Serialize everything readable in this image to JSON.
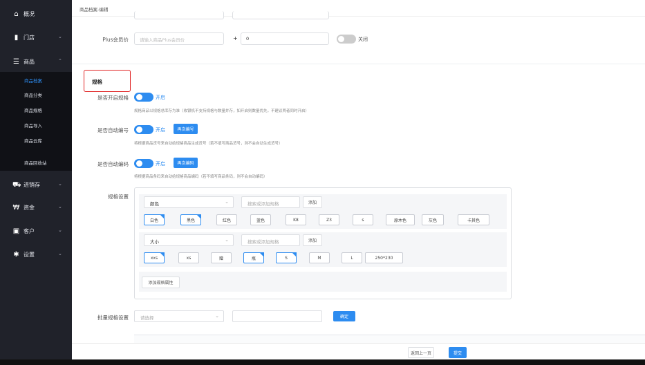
{
  "sidebar": {
    "items": [
      {
        "label": "概况",
        "icon": "home-icon",
        "glyph": "⌂",
        "chevron": ""
      },
      {
        "label": "门店",
        "icon": "store-icon",
        "glyph": "▮",
        "chevron": "⌄"
      },
      {
        "label": "商品",
        "icon": "list-icon",
        "glyph": "☰",
        "chevron": "⌃"
      },
      {
        "label": "进销存",
        "icon": "truck-icon",
        "glyph": "⛟",
        "chevron": "⌄"
      },
      {
        "label": "资金",
        "icon": "won-icon",
        "glyph": "₩",
        "chevron": "⌄"
      },
      {
        "label": "客户",
        "icon": "id-card-icon",
        "glyph": "▣",
        "chevron": "⌄"
      },
      {
        "label": "设置",
        "icon": "gear-icon",
        "glyph": "✱",
        "chevron": "⌄"
      }
    ],
    "sub_items": [
      "商品档案",
      "商品分类",
      "商品规格",
      "商品导入",
      "商品云库",
      "商品回收站"
    ]
  },
  "header": {
    "breadcrumb": "商品档案-编辑"
  },
  "plus_price": {
    "label": "Plus会员价",
    "placeholder": "请输入商品Plus会员价",
    "plus_sign": "+",
    "value": "0",
    "toggle_label": "关闭"
  },
  "spec_section": {
    "title": "规格",
    "enable_spec": {
      "label": "是否开启规格",
      "state": "开启",
      "hint": "规格商品以规格总库存为准（收银机不支持规格与数量并存，如开启则数量优先，不建议两者同时开启）"
    },
    "auto_code": {
      "label": "是否自动编号",
      "state": "开启",
      "button": "再次编号",
      "hint": "将根据商品货号来自动给规格商品生成货号（若不填写商品货号，则不会自动生成货号）"
    },
    "auto_barcode": {
      "label": "是否自动编码",
      "state": "开启",
      "button": "再次编码",
      "hint": "将根据商品条码来自动给规格商品编码（若不填写商品条码，则不会自动编码）"
    },
    "spec_settings": {
      "label": "规格设置",
      "groups": [
        {
          "name": "颜色",
          "search_placeholder": "搜索或添加规格",
          "add_label": "添加",
          "tags": [
            {
              "text": "白色",
              "selected": true
            },
            {
              "text": "黑色",
              "selected": true
            },
            {
              "text": "红色",
              "selected": false
            },
            {
              "text": "蓝色",
              "selected": false
            },
            {
              "text": "K8",
              "selected": false
            },
            {
              "text": "Z3",
              "selected": false
            },
            {
              "text": "s",
              "selected": false
            },
            {
              "text": "原木色",
              "selected": false
            },
            {
              "text": "灰色",
              "selected": false
            },
            {
              "text": "卡其色",
              "selected": false
            }
          ]
        },
        {
          "name": "大小",
          "search_placeholder": "搜索或添加规格",
          "add_label": "添加",
          "tags": [
            {
              "text": "xxs",
              "selected": true
            },
            {
              "text": "xs",
              "selected": false
            },
            {
              "text": "赠",
              "selected": false
            },
            {
              "text": "瓶",
              "selected": true
            },
            {
              "text": "S",
              "selected": true
            },
            {
              "text": "M",
              "selected": false
            },
            {
              "text": "L",
              "selected": false
            },
            {
              "text": "250*230",
              "selected": false
            }
          ]
        }
      ],
      "add_attr_label": "添加规格属性"
    },
    "batch": {
      "label": "批量规格设置",
      "placeholder": "请选择",
      "confirm": "确定"
    }
  },
  "footer": {
    "back": "返回上一页",
    "submit": "提交"
  },
  "colors": {
    "accent": "#2d8cf0",
    "sidebar_bg": "#20222a",
    "highlight_border": "#e02020"
  }
}
